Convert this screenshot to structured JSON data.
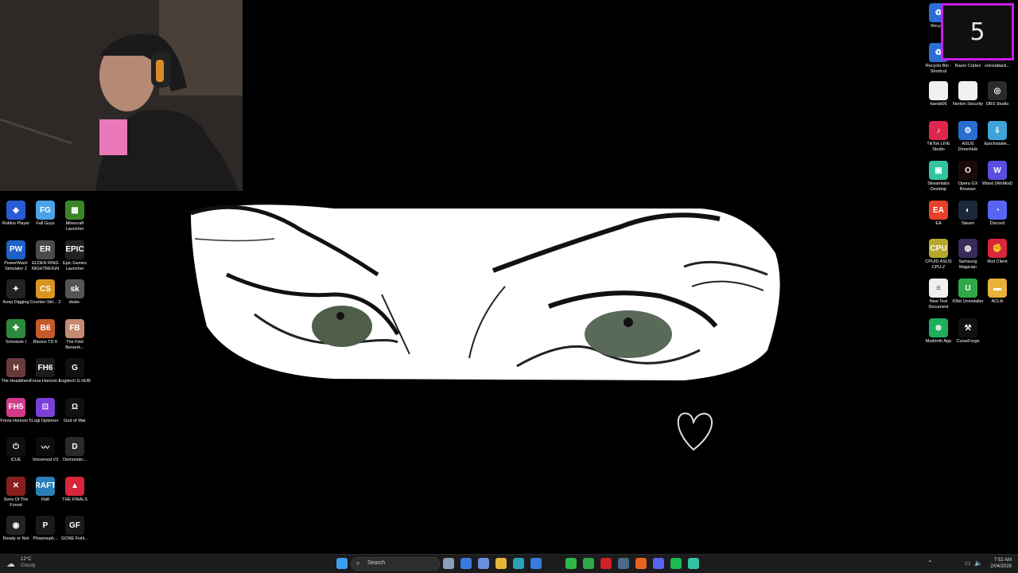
{
  "timer": {
    "value": "5"
  },
  "desktop_left": [
    {
      "name": "roblox-player",
      "label": "Roblox Player",
      "color": "#2a5bd7",
      "glyph": "◈"
    },
    {
      "name": "fall-guys",
      "label": "Fall Guys",
      "color": "#4aa3e8",
      "glyph": "FG"
    },
    {
      "name": "minecraft-launcher",
      "label": "Minecraft Launcher",
      "color": "#3c8527",
      "glyph": "▦"
    },
    {
      "name": "powerwash-simulator",
      "label": "PowerWash Simulator 2",
      "color": "#1e62c8",
      "glyph": "PW"
    },
    {
      "name": "elden-ring",
      "label": "ELDEN RING NIGHTREIGN",
      "color": "#4d4a48",
      "glyph": "ER"
    },
    {
      "name": "epic-games-launcher",
      "label": "Epic Games Launcher",
      "color": "#222",
      "glyph": "EPIC"
    },
    {
      "name": "keep-digging",
      "label": "Keep Digging",
      "color": "#222",
      "glyph": "✦"
    },
    {
      "name": "counter-strike",
      "label": "Counter-Stri... 2",
      "color": "#d9951f",
      "glyph": "CS"
    },
    {
      "name": "skate",
      "label": "skate.",
      "color": "#555",
      "glyph": "sk"
    },
    {
      "name": "schedule-i",
      "label": "Schedule I",
      "color": "#2c8a3a",
      "glyph": "✚"
    },
    {
      "name": "bloons-td6",
      "label": "Bloons TD 6",
      "color": "#c7582a",
      "glyph": "B6"
    },
    {
      "name": "the-first-berserker",
      "label": "The First Berserk...",
      "color": "#c58a72",
      "glyph": "FB"
    },
    {
      "name": "the-headliners",
      "label": "The Headliners",
      "color": "#6a3a3a",
      "glyph": "H"
    },
    {
      "name": "forza-horizon-6",
      "label": "Forza Horizon 6",
      "color": "#1b1b1b",
      "glyph": "FH6"
    },
    {
      "name": "logitech-g-hub",
      "label": "Logitech G HUB",
      "color": "#111",
      "glyph": "G"
    },
    {
      "name": "forza-horizon-5",
      "label": "Forza Horizon 5",
      "color": "#d23a8a",
      "glyph": "FH5"
    },
    {
      "name": "logi-options",
      "label": "Logi Options+",
      "color": "#7b3fd9",
      "glyph": "⊡"
    },
    {
      "name": "god-of-war",
      "label": "God of War",
      "color": "#111",
      "glyph": "Ω"
    },
    {
      "name": "icue",
      "label": "iCUE",
      "color": "#0f0f0f",
      "glyph": "⏻"
    },
    {
      "name": "voicemod-v3",
      "label": "Voicemod V3",
      "color": "#0d0d0d",
      "glyph": "〰"
    },
    {
      "name": "demonologist",
      "label": "Demonolo...",
      "color": "#2a2a2a",
      "glyph": "D"
    },
    {
      "name": "sons-of-the-forest",
      "label": "Sons Of The Forest",
      "color": "#8a1f1f",
      "glyph": "✕"
    },
    {
      "name": "raft",
      "label": "Raft",
      "color": "#2a7fb8",
      "glyph": "RAFT"
    },
    {
      "name": "the-finals",
      "label": "THE FINALS",
      "color": "#d8263a",
      "glyph": "▲"
    },
    {
      "name": "ready-or-not",
      "label": "Ready or Not",
      "color": "#222",
      "glyph": "◉"
    },
    {
      "name": "phasmophobia",
      "label": "Phasmoph...",
      "color": "#1a1a1a",
      "glyph": "P"
    },
    {
      "name": "gone-fishing",
      "label": "GONE Fishi...",
      "color": "#1a1a1a",
      "glyph": "GF"
    }
  ],
  "desktop_right": [
    {
      "name": "recycle-bin",
      "label": "Recycle",
      "color": "#2b6fd6",
      "glyph": "♻"
    },
    {
      "name": "recycle-bin-shortcut",
      "label": "Recycle Bin - Shortcut",
      "color": "#2b6fd6",
      "glyph": "♻"
    },
    {
      "name": "razer-cortex",
      "label": "Razer Cortex",
      "color": "#111",
      "glyph": "R"
    },
    {
      "name": "voiceattack",
      "label": "voiceattack...",
      "color": "#111",
      "glyph": "VA"
    },
    {
      "name": "hands06",
      "label": "hands06",
      "color": "#f0f0f0",
      "glyph": ""
    },
    {
      "name": "norton-security",
      "label": "Norton Security",
      "color": "#f0f0f0",
      "glyph": ""
    },
    {
      "name": "obs-studio",
      "label": "OBS Studio",
      "color": "#2b2b2b",
      "glyph": "◎"
    },
    {
      "name": "tiktok-live-studio",
      "label": "TikTok LIVE Studio",
      "color": "#e0254f",
      "glyph": "♪"
    },
    {
      "name": "asus-driverhub",
      "label": "ASUS DriverHub",
      "color": "#2a6ed0",
      "glyph": "⚙"
    },
    {
      "name": "epic-installer",
      "label": "EpicInstalle...",
      "color": "#3fa3d9",
      "glyph": "⇩"
    },
    {
      "name": "streamlabs-desktop",
      "label": "Streamlabs Desktop",
      "color": "#31c3a2",
      "glyph": "▣"
    },
    {
      "name": "opera-gx-browser",
      "label": "Opera GX Browser",
      "color": "#1a0a0a",
      "glyph": "O"
    },
    {
      "name": "wand-wemod",
      "label": "Wand (WeMod)",
      "color": "#5a4de0",
      "glyph": "W"
    },
    {
      "name": "ea",
      "label": "EA",
      "color": "#e8402a",
      "glyph": "EA"
    },
    {
      "name": "steam",
      "label": "Steam",
      "color": "#1b2838",
      "glyph": "◐"
    },
    {
      "name": "discord",
      "label": "Discord",
      "color": "#5865f2",
      "glyph": "◔"
    },
    {
      "name": "cpuid-asus-cpu-z",
      "label": "CPUID ASUS CPU-Z",
      "color": "#b5a82a",
      "glyph": "CPU"
    },
    {
      "name": "samsung-magician",
      "label": "Samsung Magician",
      "color": "#3a2a5a",
      "glyph": "◍"
    },
    {
      "name": "riot-client",
      "label": "Riot Client",
      "color": "#d8263a",
      "glyph": "✊"
    },
    {
      "name": "new-text-document",
      "label": "New Text Document",
      "color": "#f0f0f0",
      "glyph": "≡"
    },
    {
      "name": "iobit-uninstaller",
      "label": "IObit Uninstaller",
      "color": "#2fa84a",
      "glyph": "U"
    },
    {
      "name": "aclib",
      "label": "ACLib",
      "color": "#e8b13a",
      "glyph": "▬"
    },
    {
      "name": "modrinth-app",
      "label": "Modrinth App",
      "color": "#1fae5a",
      "glyph": "⊛"
    },
    {
      "name": "curseforge",
      "label": "CurseForge",
      "color": "#111",
      "glyph": "⚒"
    }
  ],
  "taskbar": {
    "weather_temp": "12°C",
    "weather_condition": "Cloudy",
    "search_placeholder": "Search",
    "time": "7:52 AM",
    "date": "2/04/2026",
    "pinned": [
      {
        "name": "start-button",
        "color": "#3b9ef0"
      },
      {
        "name": "task-view",
        "color": "#8aa0b8"
      },
      {
        "name": "widgets",
        "color": "#3a7be0"
      },
      {
        "name": "copilot",
        "color": "#6a8fe0"
      },
      {
        "name": "file-explorer",
        "color": "#e8b63a"
      },
      {
        "name": "edge",
        "color": "#2aa3b8"
      },
      {
        "name": "microsoft-store",
        "color": "#3a7be0"
      },
      {
        "name": "whatsapp",
        "color": "#2fb84a"
      },
      {
        "name": "iobit",
        "color": "#2fa84a"
      },
      {
        "name": "opera-gx",
        "color": "#d0202a"
      },
      {
        "name": "steam",
        "color": "#4a6a8a"
      },
      {
        "name": "firefox",
        "color": "#e8641f"
      },
      {
        "name": "discord",
        "color": "#5865f2"
      },
      {
        "name": "spotify",
        "color": "#1db954"
      },
      {
        "name": "streamlabs",
        "color": "#31c3a2"
      }
    ]
  }
}
